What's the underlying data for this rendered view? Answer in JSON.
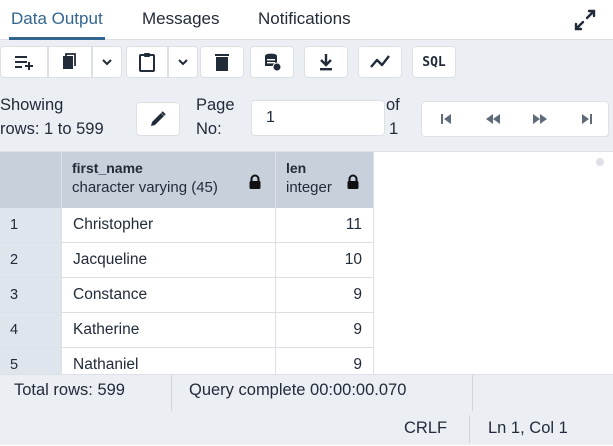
{
  "tabs": [
    {
      "label": "Data Output",
      "active": true
    },
    {
      "label": "Messages",
      "active": false
    },
    {
      "label": "Notifications",
      "active": false
    }
  ],
  "toolbar": {
    "icons": [
      "add-row-icon",
      "copy-icon",
      "chevron-down-icon",
      "paste-icon",
      "chevron-down-icon",
      "delete-icon",
      "save-data-icon",
      "download-icon",
      "graph-icon",
      "sql-button"
    ],
    "sql_label": "SQL"
  },
  "pager": {
    "showing_line1": "Showing",
    "showing_line2": "rows: 1 to 599",
    "page_line1": "Page",
    "page_line2": "No:",
    "page_value": "1",
    "of_line1": "of",
    "of_line2": "1"
  },
  "grid": {
    "columns": [
      {
        "name": "first_name",
        "type": "character varying (45)"
      },
      {
        "name": "len",
        "type": "integer"
      }
    ],
    "rows": [
      {
        "num": "1",
        "first_name": "Christopher",
        "len": "11"
      },
      {
        "num": "2",
        "first_name": "Jacqueline",
        "len": "10"
      },
      {
        "num": "3",
        "first_name": "Constance",
        "len": "9"
      },
      {
        "num": "4",
        "first_name": "Katherine",
        "len": "9"
      },
      {
        "num": "5",
        "first_name": "Nathaniel",
        "len": "9"
      }
    ]
  },
  "status": {
    "total_rows": "Total rows: 599",
    "query": "Query complete 00:00:00.070",
    "eol": "CRLF",
    "cursor": "Ln 1, Col 1"
  },
  "colors": {
    "accent": "#326690",
    "toolbar_bg": "#ebeef3",
    "header_bg": "#c8d0db",
    "border": "#dde0e6"
  }
}
